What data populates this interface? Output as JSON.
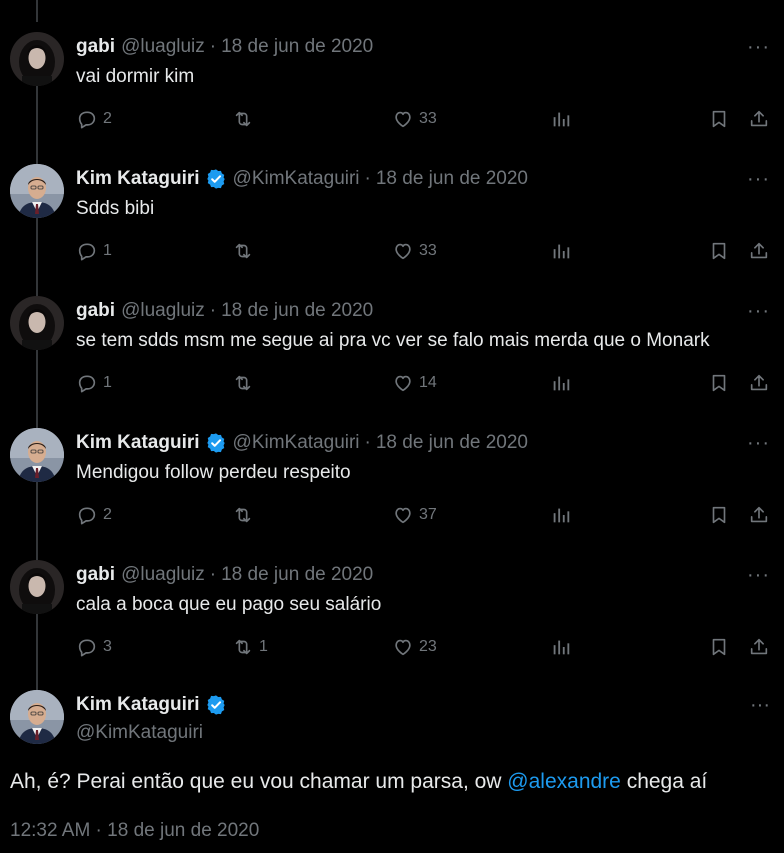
{
  "icons": {
    "reply": "reply-icon",
    "retweet": "retweet-icon",
    "like": "heart-icon",
    "views": "views-icon",
    "bookmark": "bookmark-icon",
    "share": "share-icon",
    "verified": "verified-badge-icon",
    "more": "more-icon"
  },
  "colors": {
    "background": "#000000",
    "text": "#e7e9ea",
    "muted": "#71767b",
    "accent": "#1d9bf0"
  },
  "more_label": "···",
  "separator": "·",
  "replies": [
    {
      "author": "gabi",
      "handle": "@luagluiz",
      "date": "18 de jun de 2020",
      "verified": false,
      "text": "vai dormir kim",
      "replies": "2",
      "retweets": "",
      "likes": "33"
    },
    {
      "author": "Kim Kataguiri",
      "handle": "@KimKataguiri",
      "date": "18 de jun de 2020",
      "verified": true,
      "text": "Sdds bibi",
      "replies": "1",
      "retweets": "",
      "likes": "33"
    },
    {
      "author": "gabi",
      "handle": "@luagluiz",
      "date": "18 de jun de 2020",
      "verified": false,
      "text": "se tem sdds msm me segue ai pra vc ver se falo mais merda que o Monark",
      "replies": "1",
      "retweets": "",
      "likes": "14"
    },
    {
      "author": "Kim Kataguiri",
      "handle": "@KimKataguiri",
      "date": "18 de jun de 2020",
      "verified": true,
      "text": "Mendigou follow perdeu respeito",
      "replies": "2",
      "retweets": "",
      "likes": "37"
    },
    {
      "author": "gabi",
      "handle": "@luagluiz",
      "date": "18 de jun de 2020",
      "verified": false,
      "text": "cala a boca que eu pago seu salário",
      "replies": "3",
      "retweets": "1",
      "likes": "23"
    }
  ],
  "main": {
    "author": "Kim Kataguiri",
    "handle": "@KimKataguiri",
    "text_before": "Ah, é? Perai então que eu vou chamar um parsa, ow ",
    "mention": "@alexandre",
    "text_after": " chega aí",
    "timestamp": "12:32 AM · 18 de jun de 2020"
  }
}
